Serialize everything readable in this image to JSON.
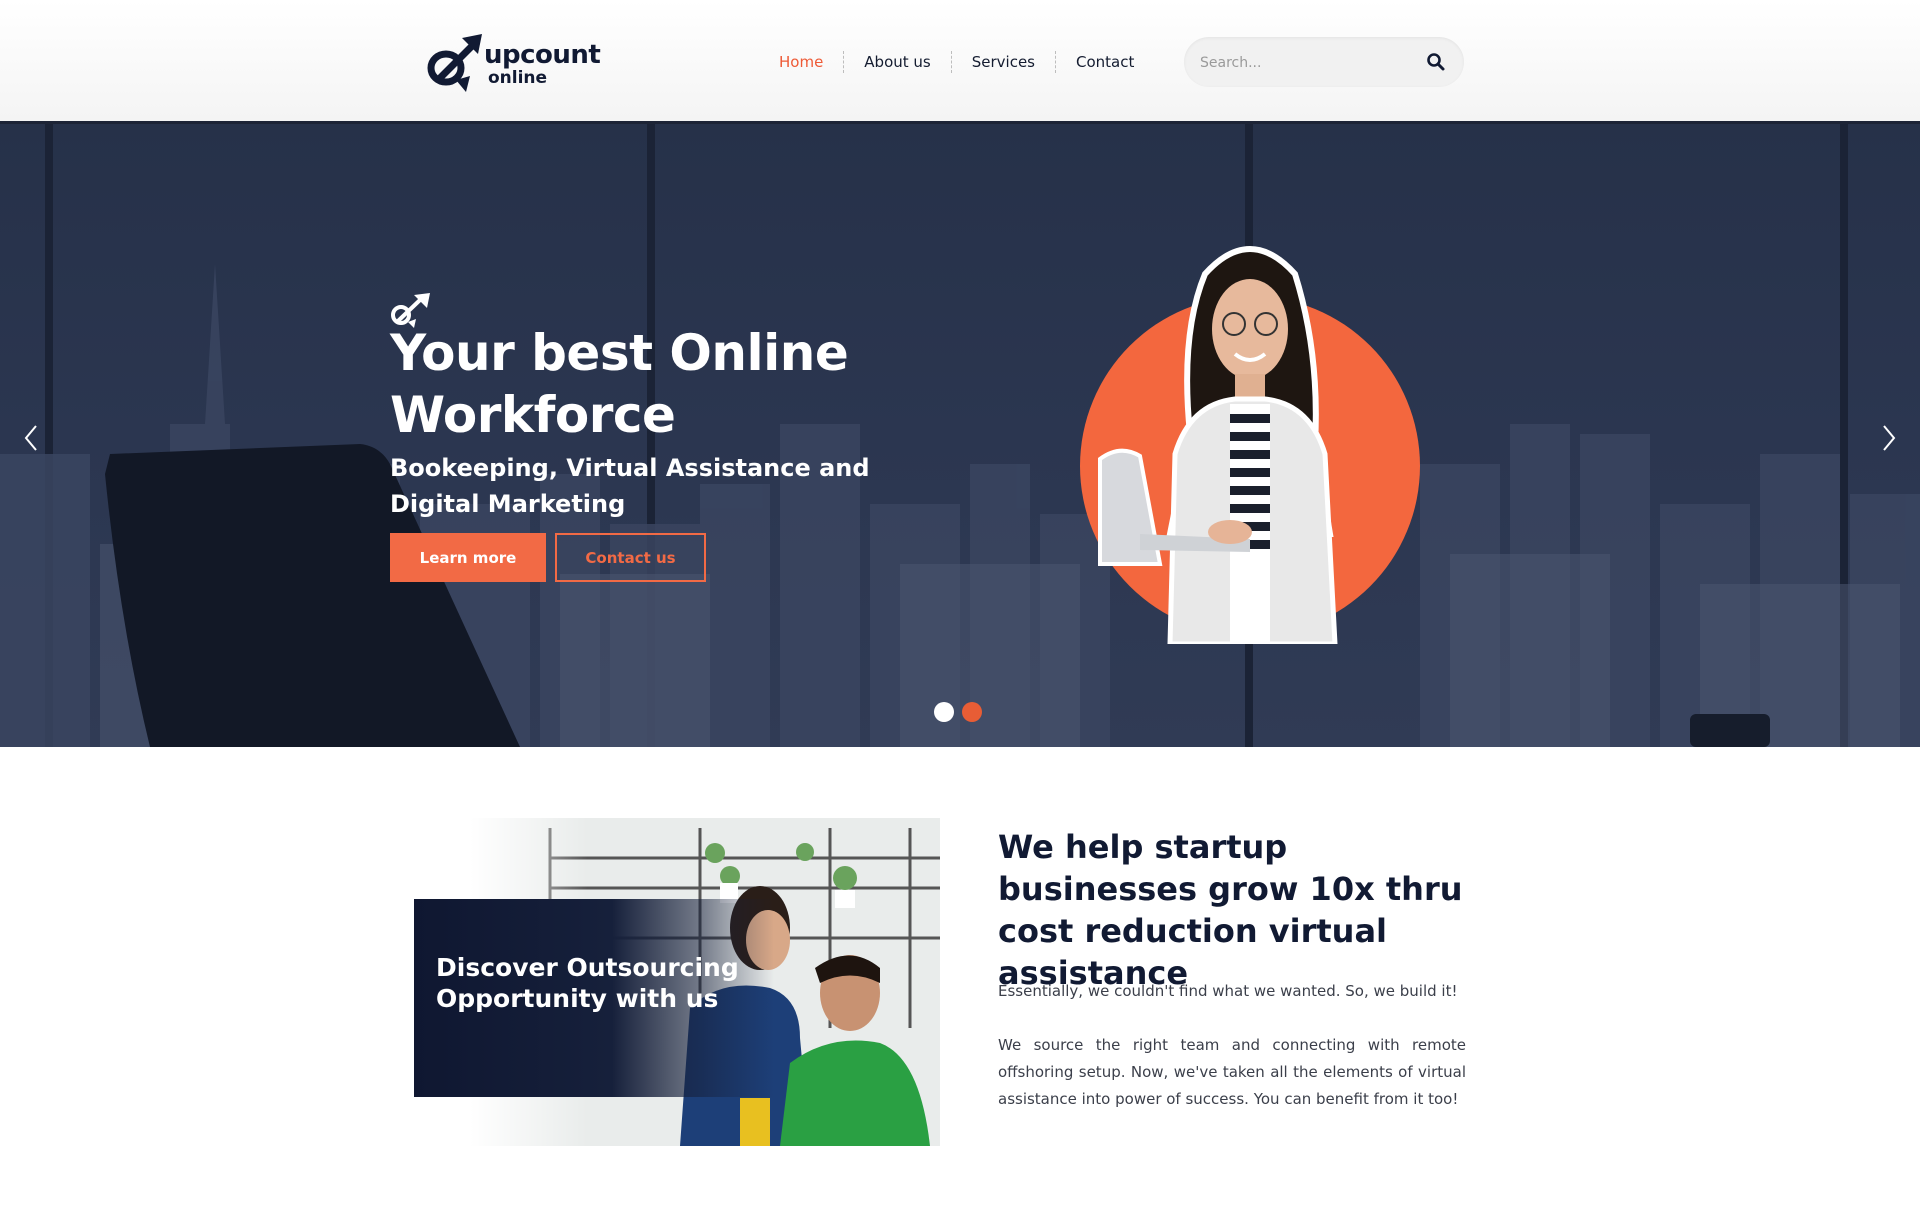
{
  "brand": {
    "name_line1": "upcount",
    "name_line2": "online"
  },
  "nav": {
    "items": [
      {
        "label": "Home",
        "active": true
      },
      {
        "label": "About us",
        "active": false
      },
      {
        "label": "Services",
        "active": false
      },
      {
        "label": "Contact",
        "active": false
      }
    ]
  },
  "search": {
    "placeholder": "Search...",
    "icon": "search-icon"
  },
  "hero": {
    "title": "Your best Online Workforce",
    "subtitle": "Bookeeping, Virtual Assistance and Digital Marketing",
    "primary_button": "Learn more",
    "secondary_button": "Contact us",
    "slides": 2,
    "active_slide": 2
  },
  "about": {
    "image_caption": "Discover Outsourcing Opportunity with us",
    "title": "We help startup businesses grow 10x thru cost reduction virtual assistance",
    "paragraph1": "Essentially, we couldn't find what we wanted. So, we build it!",
    "paragraph2": "We source the right team and connecting with remote offshoring setup. Now, we've taken all the elements of virtual assistance into power of success. You can benefit from it too!"
  },
  "colors": {
    "accent": "#f26a45",
    "navy": "#111a33",
    "hero_bg": "#2b3650"
  }
}
